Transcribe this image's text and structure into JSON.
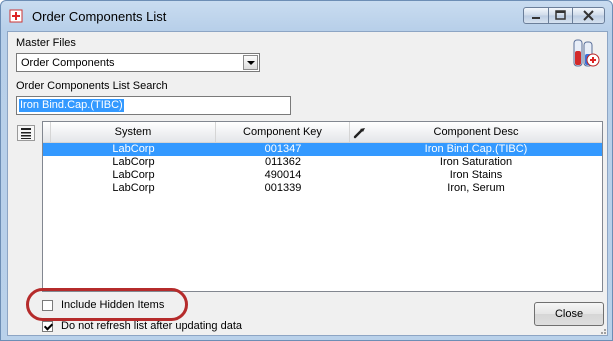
{
  "window": {
    "title": "Order Components List"
  },
  "master_files": {
    "label": "Master Files",
    "selected": "Order Components"
  },
  "search": {
    "label": "Order Components List Search",
    "value": "Iron Bind.Cap.(TIBC)"
  },
  "grid": {
    "columns": [
      "System",
      "Component Key",
      "Component Desc"
    ],
    "rows": [
      {
        "system": "LabCorp",
        "key": "001347",
        "desc": "Iron Bind.Cap.(TIBC)",
        "selected": true
      },
      {
        "system": "LabCorp",
        "key": "011362",
        "desc": "Iron Saturation",
        "selected": false
      },
      {
        "system": "LabCorp",
        "key": "490014",
        "desc": "Iron Stains",
        "selected": false
      },
      {
        "system": "LabCorp",
        "key": "001339",
        "desc": "Iron, Serum",
        "selected": false
      }
    ]
  },
  "options": {
    "include_hidden": {
      "label": "Include Hidden Items",
      "checked": false
    },
    "no_refresh": {
      "label": "Do not refresh list after updating data",
      "checked": true
    }
  },
  "buttons": {
    "close": "Close"
  },
  "colors": {
    "selection": "#3399ff",
    "highlight_ring": "#b52b2b"
  }
}
